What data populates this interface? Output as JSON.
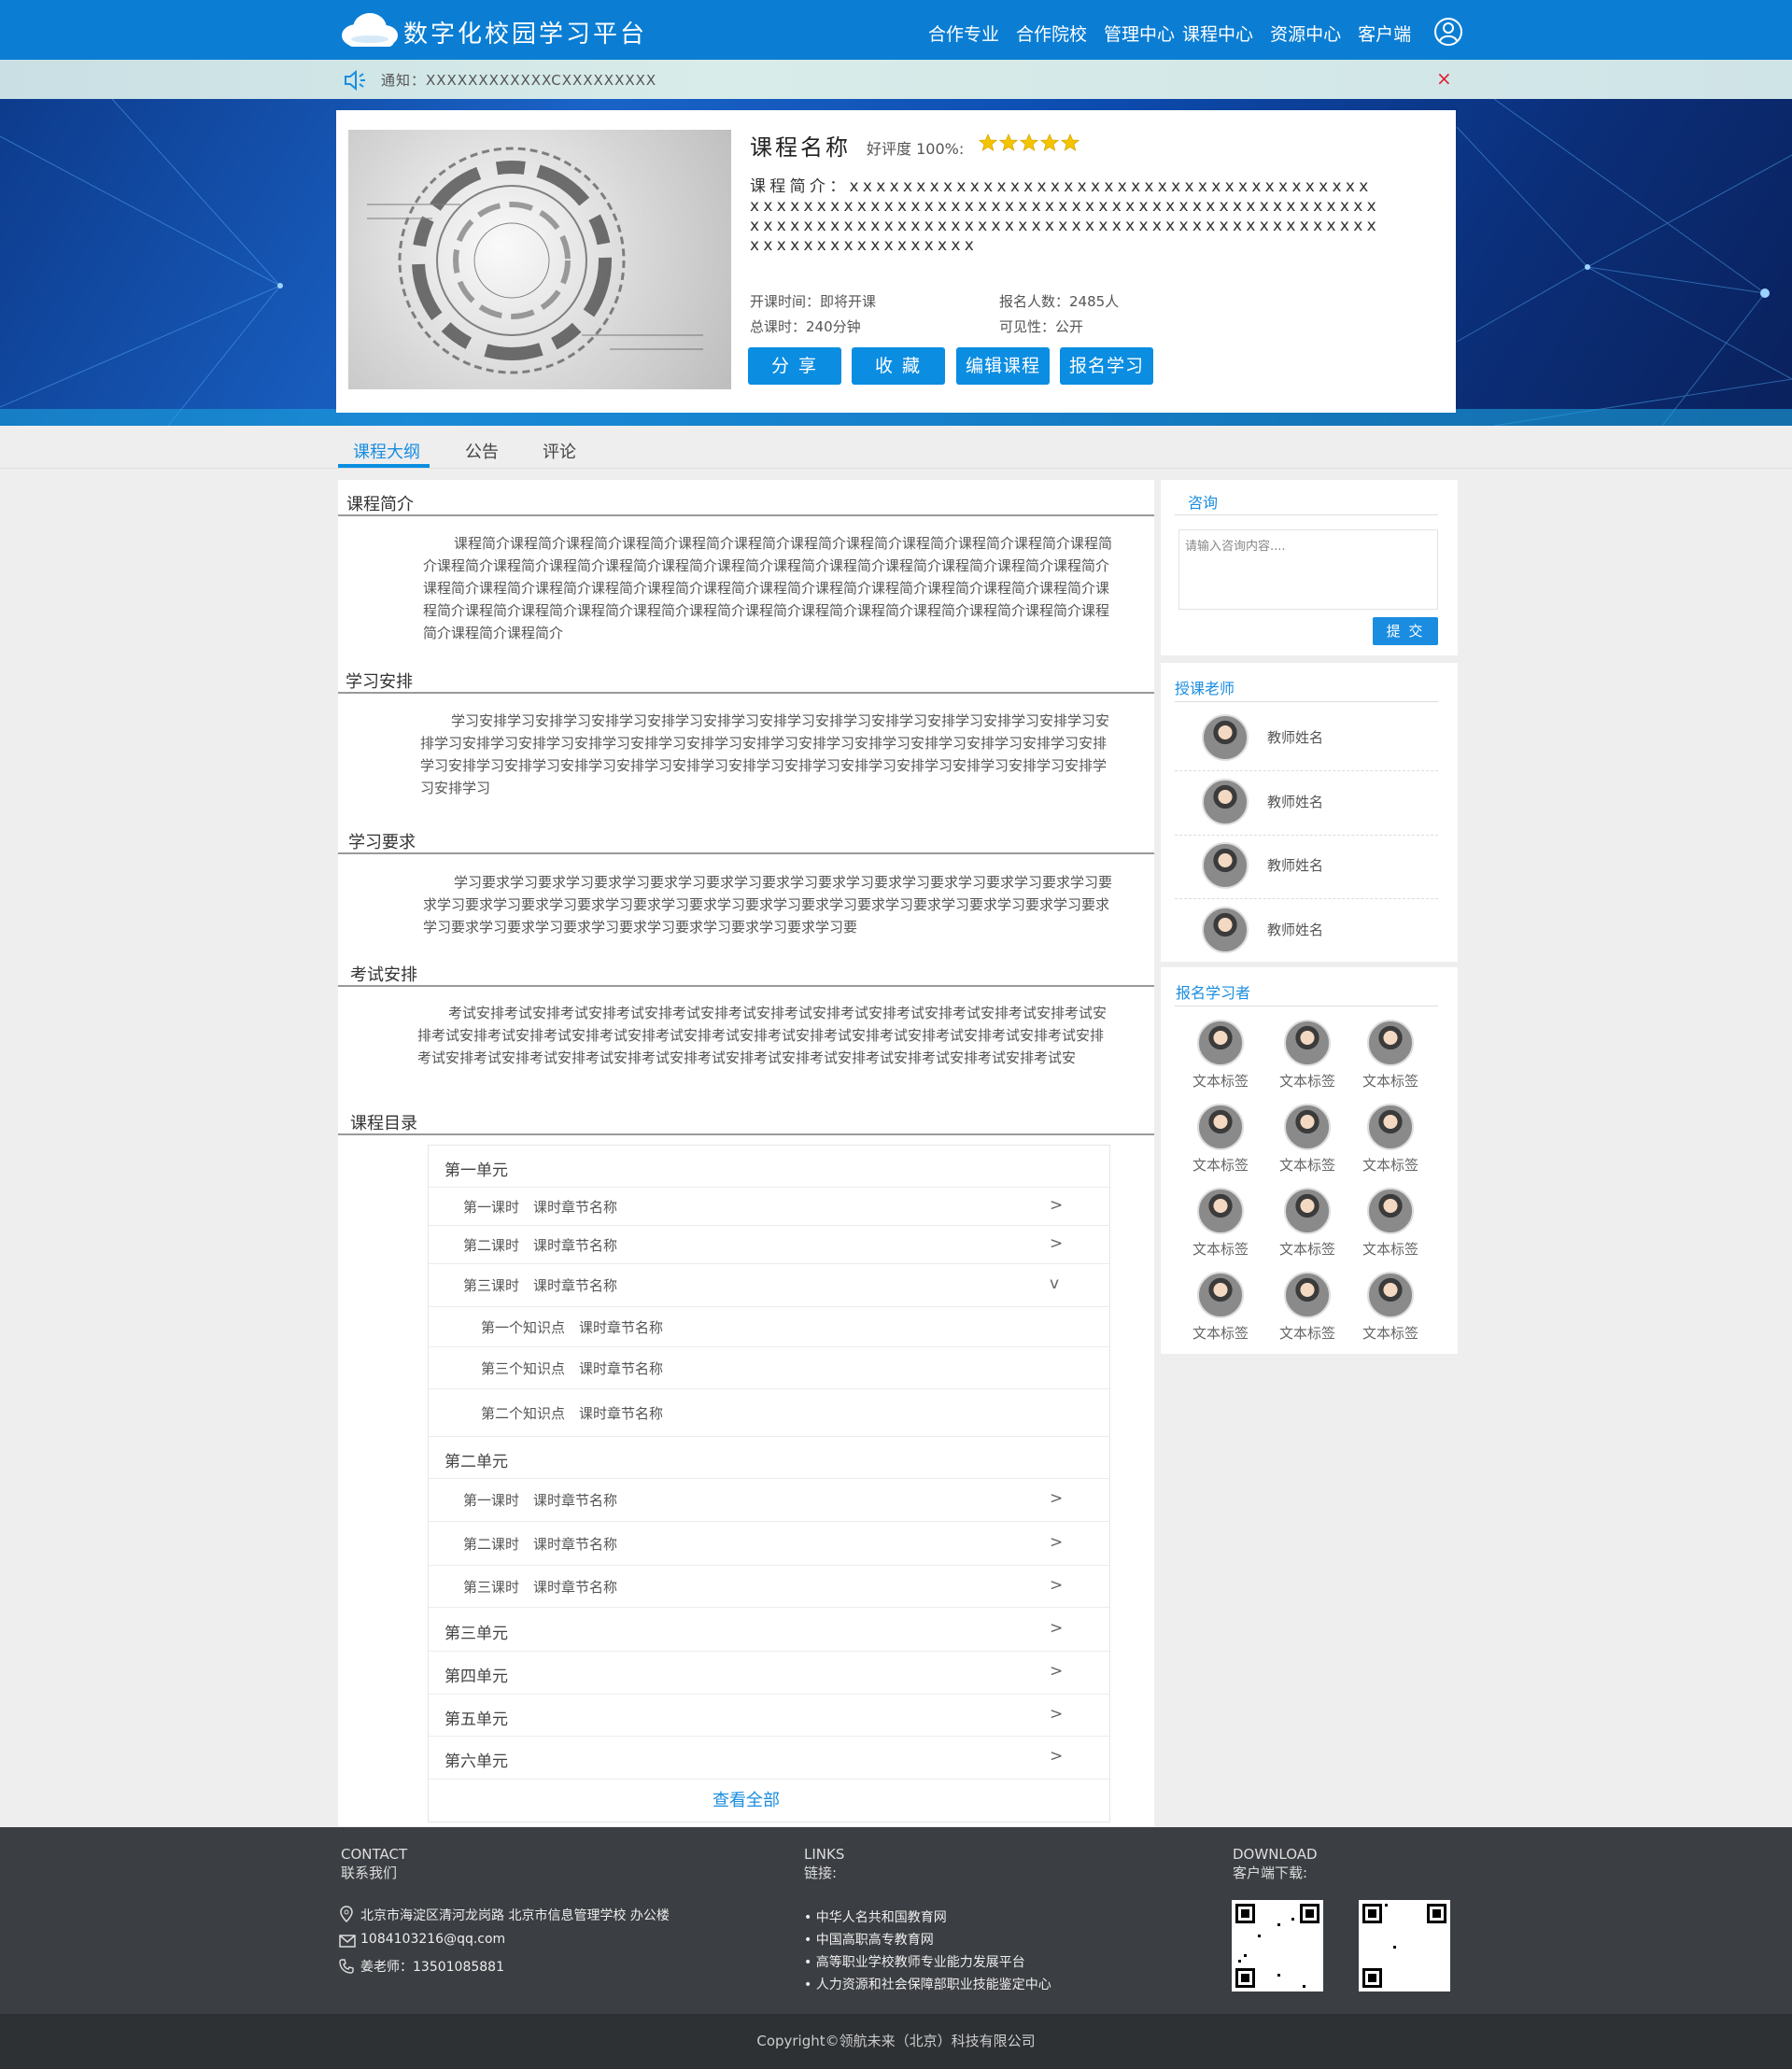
{
  "header": {
    "site_title": "数字化校园学习平台",
    "nav": [
      "合作专业",
      "合作院校",
      "管理中心",
      "课程中心",
      "资源中心",
      "客户端"
    ]
  },
  "notice": {
    "text": "通知：XXXXXXXXXXXXCXXXXXXXXX",
    "close": "×"
  },
  "course": {
    "name": "课程名称",
    "rating_label": "好评度 100%:",
    "rating_stars": 5,
    "intro": "课程简介：xxxxxxxxxxxxxxxxxxxxxxxxxxxxxxxxxxxxxxxxxxxxxxxxxxxxxxxxxxxxxxxxxxxxxxxxxxxxxxxxxxxxxxxxxxxxxxxxxxxxxxxxxxxxxxxxxxxxxxxxxxxxxxxxxxxxxxxxxxxxxxxxxxxxxx",
    "start_time": "开课时间：即将开课",
    "enrolled": "报名人数：2485人",
    "total_hours": "总课时：240分钟",
    "visibility": "可见性：公开",
    "buttons": {
      "share": "分 享",
      "favorite": "收 藏",
      "edit": "编辑课程",
      "enroll": "报名学习"
    }
  },
  "tabs": [
    "课程大纲",
    "公告",
    "评论"
  ],
  "sections": {
    "intro_title": "课程简介",
    "intro_text": "课程简介课程简介课程简介课程简介课程简介课程简介课程简介课程简介课程简介课程简介课程简介课程简介课程简介课程简介课程简介课程简介课程简介课程简介课程简介课程简介课程简介课程简介课程简介课程简介课程简介课程简介课程简介课程简介课程简介课程简介课程简介课程简介课程简介课程简介课程简介课程简介课程简介课程简介课程简介课程简介课程简介课程简介课程简介课程简介课程简介课程简介课程简介课程简介课程简介课程简介课程简介",
    "schedule_title": "学习安排",
    "schedule_text": "学习安排学习安排学习安排学习安排学习安排学习安排学习安排学习安排学习安排学习安排学习安排学习安排学习安排学习安排学习安排学习安排学习安排学习安排学习安排学习安排学习安排学习安排学习安排学习安排学习安排学习安排学习安排学习安排学习安排学习安排学习安排学习安排学习安排学习安排学习安排学习安排学习安排学习",
    "requirement_title": "学习要求",
    "requirement_text": "学习要求学习要求学习要求学习要求学习要求学习要求学习要求学习要求学习要求学习要求学习要求学习要求学习要求学习要求学习要求学习要求学习要求学习要求学习要求学习要求学习要求学习要求学习要求学习要求学习要求学习要求学习要求学习要求学习要求学习要求学习要求学习要",
    "exam_title": "考试安排",
    "exam_text": "考试安排考试安排考试安排考试安排考试安排考试安排考试安排考试安排考试安排考试安排考试安排考试安排考试安排考试安排考试安排考试安排考试安排考试安排考试安排考试安排考试安排考试安排考试安排考试安排考试安排考试安排考试安排考试安排考试安排考试安排考试安排考试安排考试安排考试安排考试安排考试安",
    "catalog_title": "课程目录"
  },
  "catalog": {
    "rows": [
      {
        "kind": "unit",
        "text": "第一单元",
        "chev": ""
      },
      {
        "kind": "lesson",
        "text": "第一课时　课时章节名称",
        "chev": ">"
      },
      {
        "kind": "lesson",
        "text": "第二课时　课时章节名称",
        "chev": ">"
      },
      {
        "kind": "lesson",
        "text": "第三课时　课时章节名称",
        "chev": "v"
      },
      {
        "kind": "point",
        "text": "第一个知识点　课时章节名称",
        "chev": ""
      },
      {
        "kind": "point",
        "text": "第三个知识点　课时章节名称",
        "chev": ""
      },
      {
        "kind": "point",
        "text": "第二个知识点　课时章节名称",
        "chev": ""
      },
      {
        "kind": "unit",
        "text": "第二单元",
        "chev": ""
      },
      {
        "kind": "lesson",
        "text": "第一课时　课时章节名称",
        "chev": ">"
      },
      {
        "kind": "lesson",
        "text": "第二课时　课时章节名称",
        "chev": ">"
      },
      {
        "kind": "lesson",
        "text": "第三课时　课时章节名称",
        "chev": ">"
      },
      {
        "kind": "unit",
        "text": "第三单元",
        "chev": ">"
      },
      {
        "kind": "unit",
        "text": "第四单元",
        "chev": ">"
      },
      {
        "kind": "unit",
        "text": "第五单元",
        "chev": ">"
      },
      {
        "kind": "unit",
        "text": "第六单元",
        "chev": ">"
      }
    ],
    "view_all": "查看全部"
  },
  "sidebar": {
    "consult_title": "咨询",
    "consult_placeholder": "请输入咨询内容....",
    "submit": "提 交",
    "teachers_title": "授课老师",
    "teachers": [
      "教师姓名",
      "教师姓名",
      "教师姓名",
      "教师姓名"
    ],
    "students_title": "报名学习者",
    "students": [
      "文本标签",
      "文本标签",
      "文本标签",
      "文本标签",
      "文本标签",
      "文本标签",
      "文本标签",
      "文本标签",
      "文本标签",
      "文本标签",
      "文本标签",
      "文本标签"
    ]
  },
  "footer": {
    "contact_en": "CONTACT",
    "contact_cn": "联系我们",
    "address": "北京市海淀区清河龙岗路 北京市信息管理学校 办公楼",
    "email": "1084103216@qq.com",
    "phone": "姜老师：13501085881",
    "links_en": "LINKS",
    "links_cn": "链接:",
    "links": [
      "• 中华人名共和国教育网",
      "• 中国高职高专教育网",
      "• 高等职业学校教师专业能力发展平台",
      "• 人力资源和社会保障部职业技能鉴定中心"
    ],
    "download_en": "DOWNLOAD",
    "download_cn": "客户端下载:",
    "copyright": "Copyright©领航未来（北京）科技有限公司"
  },
  "colors": {
    "primary": "#0b7ed4",
    "button": "#0b8de2",
    "link": "#1a8de0",
    "star": "#f5c400",
    "footer": "#3b3e42"
  }
}
